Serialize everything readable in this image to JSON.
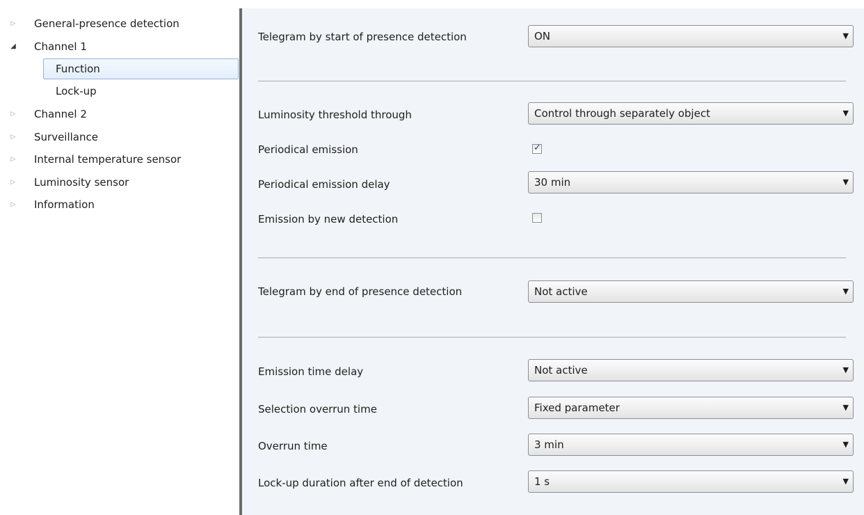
{
  "sidebar": {
    "items": [
      {
        "label": "General-presence detection",
        "arrow": "▷"
      },
      {
        "label": "Channel 1",
        "arrow": "◢"
      },
      {
        "label": "Function"
      },
      {
        "label": "Lock-up"
      },
      {
        "label": "Channel 2",
        "arrow": "▷"
      },
      {
        "label": "Surveillance",
        "arrow": "▷"
      },
      {
        "label": "Internal temperature sensor",
        "arrow": "▷"
      },
      {
        "label": "Luminosity sensor",
        "arrow": "▷"
      },
      {
        "label": "Information",
        "arrow": "▷"
      }
    ]
  },
  "params": {
    "telegram_start": {
      "label": "Telegram by start of presence detection",
      "value": "ON"
    },
    "luminosity_threshold": {
      "label": "Luminosity threshold through",
      "value": "Control through separately object"
    },
    "periodical_emission": {
      "label": "Periodical emission",
      "checked": true,
      "mark": "✓"
    },
    "periodical_delay": {
      "label": "Periodical emission delay",
      "value": "30 min"
    },
    "emission_new_detection": {
      "label": "Emission by new detection",
      "checked": false
    },
    "telegram_end": {
      "label": "Telegram by end of presence detection",
      "value": "Not active"
    },
    "emission_time_delay": {
      "label": "Emission time delay",
      "value": "Not active"
    },
    "selection_overrun": {
      "label": "Selection overrun time",
      "value": "Fixed parameter"
    },
    "overrun_time": {
      "label": "Overrun time",
      "value": "3 min"
    },
    "lockup_duration": {
      "label": "Lock-up duration after end of detection",
      "value": "1 s"
    }
  },
  "caret": "▼",
  "colors": {
    "panel_bg": "#f1f4f8",
    "selection_border": "#8fb6e2",
    "checkmark": "#2a3d8f",
    "splitter": "#6a6a6a"
  }
}
